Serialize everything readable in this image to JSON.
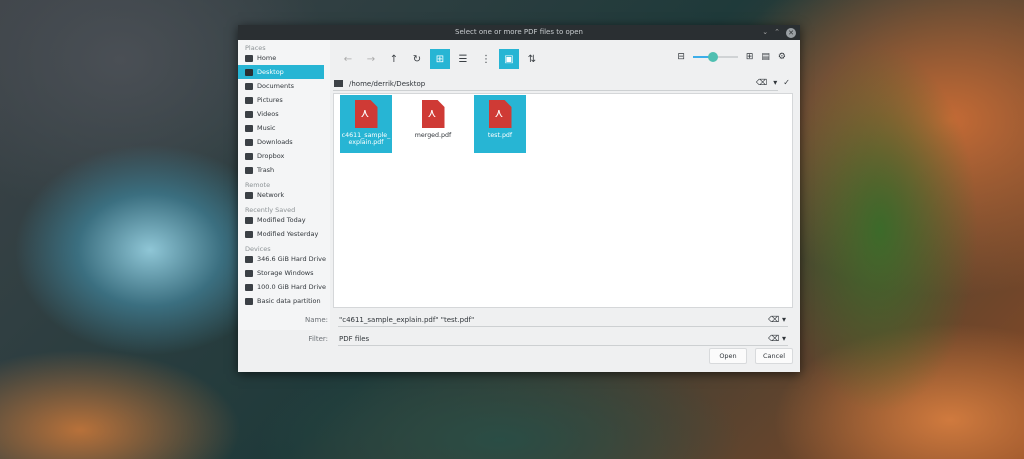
{
  "window": {
    "title": "Select one or more PDF files to open"
  },
  "sidebar": {
    "sections": [
      {
        "label": "Places",
        "items": [
          {
            "label": "Home",
            "icon": "home-icon"
          },
          {
            "label": "Desktop",
            "icon": "desktop-icon",
            "selected": true
          },
          {
            "label": "Documents",
            "icon": "document-icon"
          },
          {
            "label": "Pictures",
            "icon": "pictures-icon"
          },
          {
            "label": "Videos",
            "icon": "video-icon"
          },
          {
            "label": "Music",
            "icon": "music-icon"
          },
          {
            "label": "Downloads",
            "icon": "download-icon"
          },
          {
            "label": "Dropbox",
            "icon": "dropbox-icon"
          },
          {
            "label": "Trash",
            "icon": "trash-icon"
          }
        ]
      },
      {
        "label": "Remote",
        "items": [
          {
            "label": "Network",
            "icon": "network-icon"
          }
        ]
      },
      {
        "label": "Recently Saved",
        "items": [
          {
            "label": "Modified Today",
            "icon": "calendar-icon"
          },
          {
            "label": "Modified Yesterday",
            "icon": "calendar-icon"
          }
        ]
      },
      {
        "label": "Devices",
        "items": [
          {
            "label": "346.6 GiB Hard Drive",
            "icon": "drive-icon"
          },
          {
            "label": "Storage Windows",
            "icon": "drive-icon"
          },
          {
            "label": "100.0 GiB Hard Drive",
            "icon": "drive-icon"
          },
          {
            "label": "Basic data partition",
            "icon": "drive-icon"
          }
        ]
      }
    ]
  },
  "toolbar": {
    "zoom_level": 0.45
  },
  "path": "/home/derrik/Desktop",
  "files": [
    {
      "name": "c4611_sample_\nexplain.pdf",
      "selected": true
    },
    {
      "name": "merged.pdf",
      "selected": false
    },
    {
      "name": "test.pdf",
      "selected": true
    }
  ],
  "name_label": "Name:",
  "name_value": "\"c4611_sample_explain.pdf\" \"test.pdf\"",
  "filter_label": "Filter:",
  "filter_value": "PDF files",
  "open_label": "Open",
  "cancel_label": "Cancel"
}
